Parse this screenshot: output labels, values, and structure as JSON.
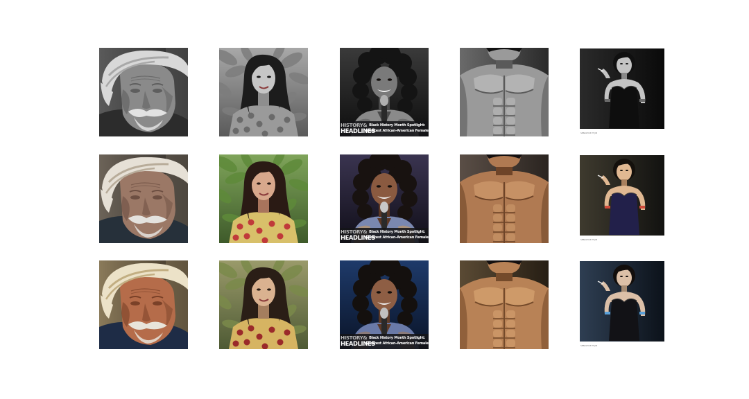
{
  "figure": {
    "rows": [
      {
        "row_style": "grayscale"
      },
      {
        "row_style": "color"
      },
      {
        "row_style": "color-variant"
      }
    ],
    "columns": [
      {
        "subject": "elderly man with headwrap and gray mustache",
        "brand_line1": "",
        "brand_line2": "",
        "headline_line1": "",
        "headline_line2": "",
        "small_caption": ""
      },
      {
        "subject": "young woman with long dark hair among foliage",
        "brand_line1": "",
        "brand_line2": "",
        "headline_line1": "",
        "headline_line2": "",
        "small_caption": ""
      },
      {
        "subject": "singer with curly hair at microphone",
        "brand_line1": "HISTORY&",
        "brand_line2": "HEADLINES",
        "headline_line1": "Black History Month Spotlight:",
        "headline_line2": "Greatest African-American Female Singers!",
        "small_caption": ""
      },
      {
        "subject": "shirtless muscular man",
        "brand_line1": "",
        "brand_line2": "",
        "headline_line1": "",
        "headline_line2": "",
        "small_caption": ""
      },
      {
        "subject": "woman in black dress holding cigarette",
        "brand_line1": "",
        "brand_line2": "",
        "headline_line1": "",
        "headline_line2": "",
        "small_caption": "SEBASTI.M ET JIB"
      }
    ]
  }
}
